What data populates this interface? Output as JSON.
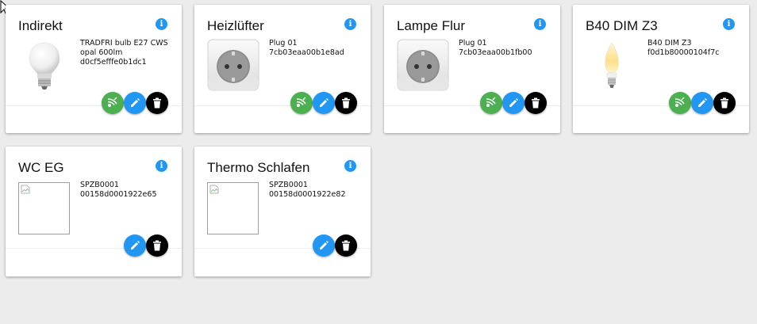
{
  "colors": {
    "accent": "#2196f3",
    "success": "#4caf50",
    "danger": "#000000"
  },
  "devices": [
    {
      "name": "Indirekt",
      "line1": "TRADFRI bulb E27 CWS",
      "line2": "opal 600lm",
      "line3": "d0cf5efffe0b1dc1",
      "image": "bulb-e27",
      "actions": [
        "identify",
        "edit",
        "delete"
      ]
    },
    {
      "name": "Heizlüfter",
      "line1": "Plug 01",
      "line2": "7cb03eaa00b1e8ad",
      "image": "smart-plug",
      "actions": [
        "identify",
        "edit",
        "delete"
      ]
    },
    {
      "name": "Lampe Flur",
      "line1": "Plug 01",
      "line2": "7cb03eaa00b1fb00",
      "image": "smart-plug",
      "actions": [
        "identify",
        "edit",
        "delete"
      ]
    },
    {
      "name": "B40 DIM Z3",
      "line1": "B40 DIM Z3",
      "line2": "f0d1b80000104f7c",
      "image": "candle-bulb",
      "actions": [
        "identify",
        "edit",
        "delete"
      ]
    },
    {
      "name": "WC EG",
      "line1": "SPZB0001",
      "line2": "00158d0001922e65",
      "image": "broken-image",
      "actions": [
        "edit",
        "delete"
      ]
    },
    {
      "name": "Thermo Schlafen",
      "line1": "SPZB0001",
      "line2": "00158d0001922e82",
      "image": "broken-image",
      "actions": [
        "edit",
        "delete"
      ]
    }
  ]
}
